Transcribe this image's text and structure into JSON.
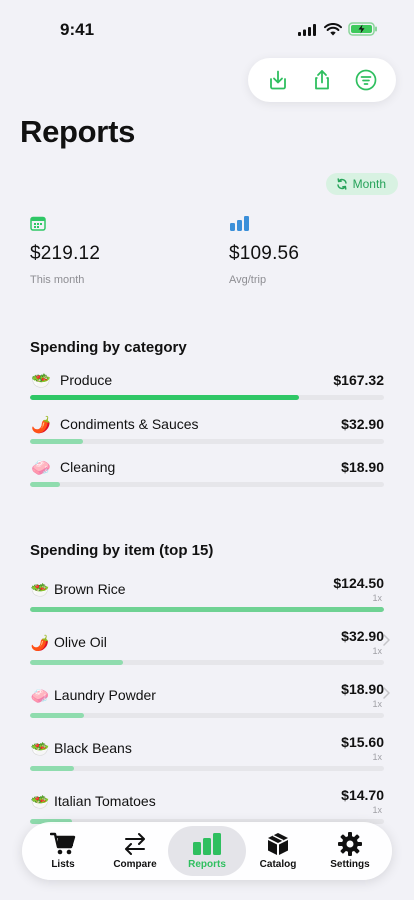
{
  "status_bar": {
    "time": "9:41"
  },
  "page": {
    "title": "Reports",
    "period_label": "Month"
  },
  "stats": [
    {
      "value": "$219.12",
      "label": "This month",
      "icon": "calendar-icon"
    },
    {
      "value": "$109.56",
      "label": "Avg/trip",
      "icon": "bar-chart-icon"
    }
  ],
  "by_category": {
    "title": "Spending by category",
    "items": [
      {
        "emoji": "🥗",
        "name": "Produce",
        "amount": "$167.32",
        "fill": 0.76,
        "color": "#2fc766"
      },
      {
        "emoji": "🌶️",
        "name": "Condiments & Sauces",
        "amount": "$32.90",
        "fill": 0.15,
        "color": "#8fdcae"
      },
      {
        "emoji": "🧼",
        "name": "Cleaning",
        "amount": "$18.90",
        "fill": 0.085,
        "color": "#8fdcae"
      }
    ]
  },
  "by_item": {
    "title": "Spending by item (top 15)",
    "items": [
      {
        "emoji": "🥗",
        "name": "Brown Rice",
        "amount": "$124.50",
        "count": "1x",
        "fill": 1.0
      },
      {
        "emoji": "🌶️",
        "name": "Olive Oil",
        "amount": "$32.90",
        "count": "1x",
        "fill": 0.264
      },
      {
        "emoji": "🧼",
        "name": "Laundry Powder",
        "amount": "$18.90",
        "count": "1x",
        "fill": 0.152
      },
      {
        "emoji": "🥗",
        "name": "Black Beans",
        "amount": "$15.60",
        "count": "1x",
        "fill": 0.125
      },
      {
        "emoji": "🥗",
        "name": "Italian Tomatoes",
        "amount": "$14.70",
        "count": "1x",
        "fill": 0.118
      }
    ]
  },
  "tabs": [
    {
      "label": "Lists",
      "icon": "cart-icon"
    },
    {
      "label": "Compare",
      "icon": "arrows-icon"
    },
    {
      "label": "Reports",
      "icon": "bar-chart-icon"
    },
    {
      "label": "Catalog",
      "icon": "box-icon"
    },
    {
      "label": "Settings",
      "icon": "gear-icon"
    }
  ],
  "colors": {
    "accent": "#2fc766",
    "accent_soft": "#8fdcae",
    "background": "#f2f2f7"
  }
}
